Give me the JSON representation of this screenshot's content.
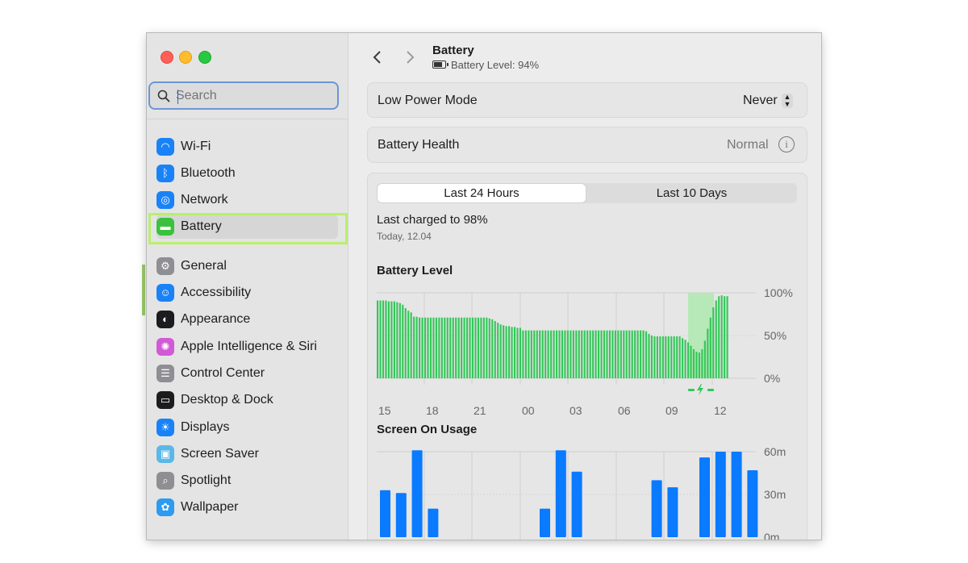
{
  "sidebar": {
    "search_placeholder": "Search",
    "items": [
      {
        "label": "Wi-Fi",
        "icon": "wifi-icon",
        "color": "#1a82f7"
      },
      {
        "label": "Bluetooth",
        "icon": "bluetooth-icon",
        "color": "#1a82f7"
      },
      {
        "label": "Network",
        "icon": "globe-icon",
        "color": "#1a82f7"
      },
      {
        "label": "Battery",
        "icon": "battery-icon",
        "color": "#3ac23f",
        "selected": true
      },
      {
        "label": "General",
        "icon": "gear-icon",
        "color": "#8e8e93"
      },
      {
        "label": "Accessibility",
        "icon": "accessibility-icon",
        "color": "#1a82f7"
      },
      {
        "label": "Appearance",
        "icon": "appearance-icon",
        "color": "#1c1c1e"
      },
      {
        "label": "Apple Intelligence & Siri",
        "icon": "siri-icon",
        "color": "#d25ad6"
      },
      {
        "label": "Control Center",
        "icon": "control-center-icon",
        "color": "#8e8e93"
      },
      {
        "label": "Desktop & Dock",
        "icon": "desktop-dock-icon",
        "color": "#1c1c1e"
      },
      {
        "label": "Displays",
        "icon": "displays-icon",
        "color": "#1a82f7"
      },
      {
        "label": "Screen Saver",
        "icon": "screen-saver-icon",
        "color": "#5ab8e8"
      },
      {
        "label": "Spotlight",
        "icon": "spotlight-icon",
        "color": "#8e8e93"
      },
      {
        "label": "Wallpaper",
        "icon": "wallpaper-icon",
        "color": "#2c9bf0"
      }
    ]
  },
  "header": {
    "back_icon": "chevron-left-icon",
    "forward_icon": "chevron-right-icon",
    "title": "Battery",
    "subtitle": "Battery Level: 94%"
  },
  "low_power": {
    "label": "Low Power Mode",
    "value": "Never"
  },
  "health": {
    "label": "Battery Health",
    "value": "Normal"
  },
  "usage": {
    "tabs": [
      "Last 24 Hours",
      "Last 10 Days"
    ],
    "active_tab": 0,
    "last_charged": "Last charged to 98%",
    "last_charged_time": "Today, 12.04"
  },
  "accent_colors": {
    "battery_green": "#34c759",
    "charging_band": "#b7e8b8",
    "usage_blue": "#0a7aff"
  },
  "chart_data": [
    {
      "type": "bar",
      "title": "Battery Level",
      "x_ticks": [
        "15",
        "18",
        "21",
        "00",
        "03",
        "06",
        "09",
        "12"
      ],
      "y_ticks": [
        "100%",
        "50%",
        "0%"
      ],
      "ylim": [
        0,
        100
      ],
      "grid": true,
      "charging_window": "about 10:30–12:00",
      "values": [
        91,
        91,
        91,
        91,
        90,
        90,
        90,
        89,
        88,
        86,
        82,
        79,
        77,
        72,
        72,
        71,
        71,
        71,
        71,
        71,
        71,
        71,
        71,
        71,
        71,
        71,
        71,
        71,
        71,
        71,
        71,
        71,
        71,
        71,
        71,
        71,
        71,
        71,
        71,
        71,
        70,
        69,
        67,
        65,
        63,
        62,
        61,
        61,
        60,
        60,
        59,
        59,
        56,
        56,
        56,
        56,
        56,
        56,
        56,
        56,
        56,
        56,
        56,
        56,
        56,
        56,
        56,
        56,
        56,
        56,
        56,
        56,
        56,
        56,
        56,
        56,
        56,
        56,
        56,
        56,
        56,
        56,
        56,
        56,
        56,
        56,
        56,
        56,
        56,
        56,
        56,
        56,
        56,
        56,
        56,
        56,
        55,
        52,
        50,
        49,
        49,
        49,
        49,
        49,
        49,
        49,
        49,
        49,
        49,
        47,
        45,
        42,
        38,
        34,
        31,
        30,
        34,
        44,
        58,
        71,
        83,
        91,
        96,
        97,
        96,
        96
      ],
      "x_range_hours": [
        14,
        12.25
      ]
    },
    {
      "type": "bar",
      "title": "Screen On Usage",
      "x_ticks": [
        "15",
        "18",
        "21",
        "00",
        "03",
        "06",
        "09",
        "12"
      ],
      "y_ticks": [
        "60m",
        "30m",
        "0m"
      ],
      "ylim": [
        0,
        60
      ],
      "grid": true,
      "hours": [
        "14",
        "15",
        "16",
        "17",
        "18",
        "19",
        "20",
        "21",
        "22",
        "23",
        "00",
        "01",
        "02",
        "03",
        "04",
        "05",
        "06",
        "07",
        "08",
        "09",
        "10",
        "11",
        "12"
      ],
      "values": [
        33,
        31,
        61,
        20,
        0,
        0,
        0,
        0,
        0,
        0,
        20,
        61,
        46,
        0,
        0,
        0,
        0,
        40,
        35,
        0,
        56,
        60,
        60,
        47
      ]
    }
  ]
}
